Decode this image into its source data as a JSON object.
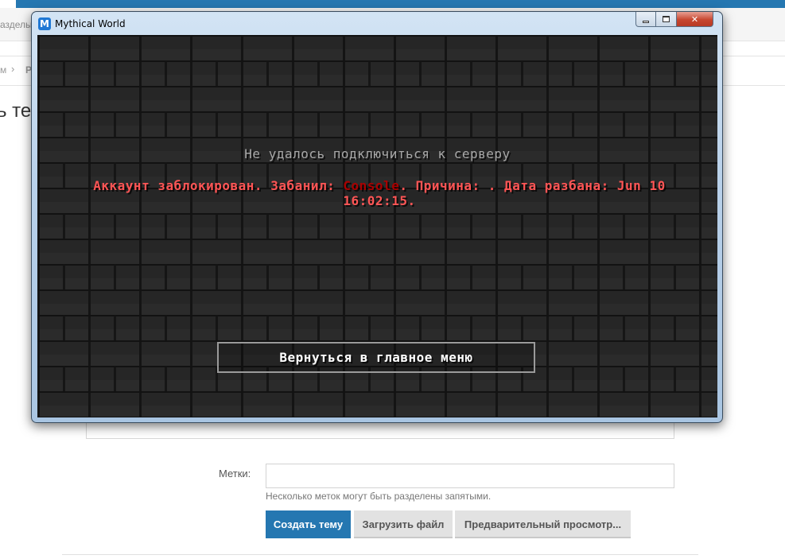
{
  "background": {
    "nav_text": "азделы",
    "breadcrumb": {
      "first": "м",
      "second": "Р"
    },
    "page_heading": "ь тем",
    "tags_label": "Метки:",
    "tags_input_value": "",
    "tags_hint": "Несколько меток могут быть разделены запятыми.",
    "buttons": {
      "create": "Создать тему",
      "upload": "Загрузить файл",
      "preview": "Предварительный просмотр..."
    }
  },
  "window": {
    "title": "Mythical World",
    "app_icon_letter": "M",
    "controls": {
      "minimize": "minimize-icon",
      "maximize": "maximize-icon",
      "close": "✕"
    }
  },
  "game": {
    "title": "Не удалось подключиться к серверу",
    "reason_prefix": "Аккаунт заблокирован. Забанил: ",
    "banned_by": "Console",
    "reason_suffix": ". Причина: . Дата разбана: Jun 10 16:02:15.",
    "back_button": "Вернуться в главное меню",
    "colors": {
      "title": "#a8a8a8",
      "reason": "#ff5555",
      "banned_by": "#aa0000"
    }
  }
}
